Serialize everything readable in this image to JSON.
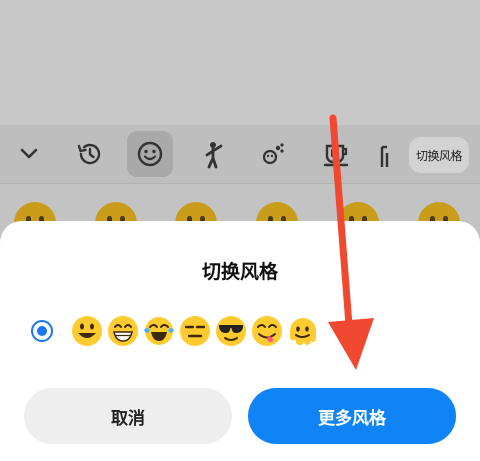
{
  "toolbar": {
    "icons": [
      "chevron-down-icon",
      "recent-clock-icon",
      "smiley-face-icon",
      "person-gesture-icon",
      "animals-icon",
      "food-cup-icon",
      "objects-icon"
    ],
    "style_button_label": "切换风格"
  },
  "dialog": {
    "title": "切换风格",
    "selected_style": "default",
    "preview_emojis": [
      "grinning-face",
      "beaming-face",
      "tears-of-joy-face",
      "expressionless-face",
      "sunglasses-face",
      "yum-face",
      "melting-face"
    ],
    "cancel_label": "取消",
    "more_label": "更多风格"
  },
  "colors": {
    "accent": "#1184f5",
    "annotation_arrow": "#f0492f"
  }
}
